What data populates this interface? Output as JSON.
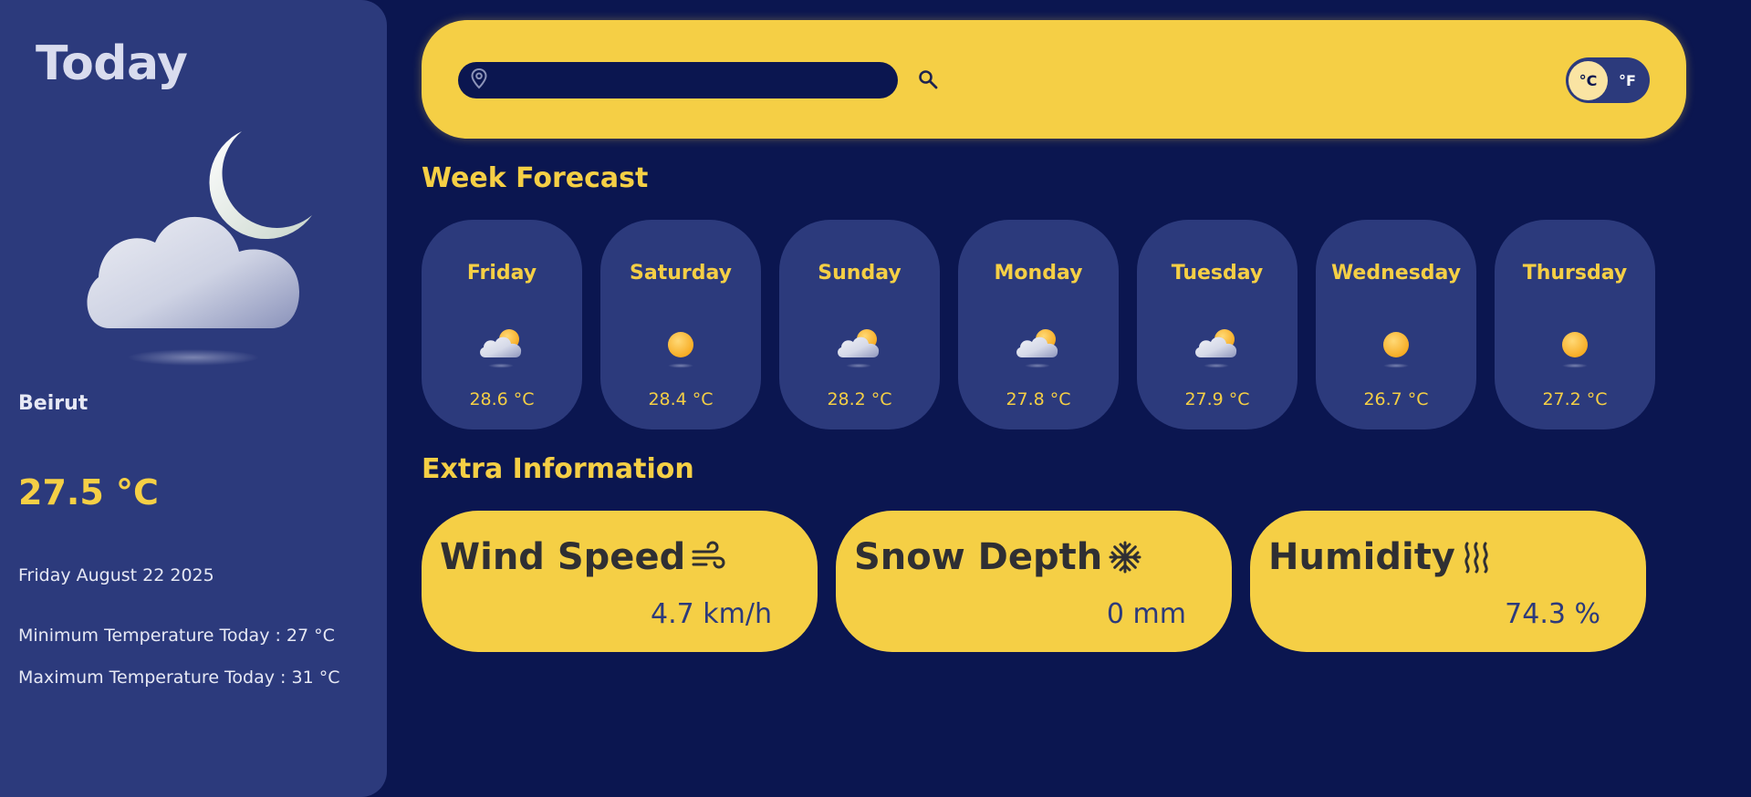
{
  "today": {
    "title": "Today",
    "city": "Beirut",
    "temperature": "27.5 °C",
    "date": "Friday August 22 2025",
    "min_temp": "Minimum Temperature Today : 27 °C",
    "max_temp": "Maximum Temperature Today : 31 °C",
    "icon": "moon-cloud-icon"
  },
  "search": {
    "placeholder": "",
    "value": "",
    "location_icon": "location-pin-icon",
    "search_icon": "search-icon"
  },
  "units": {
    "celsius_label": "°C",
    "fahrenheit_label": "°F",
    "selected": "celsius"
  },
  "week": {
    "title": "Week Forecast",
    "days": [
      {
        "name": "Friday",
        "temp": "28.6 °C",
        "icon": "partly-sunny-icon"
      },
      {
        "name": "Saturday",
        "temp": "28.4 °C",
        "icon": "sun-icon"
      },
      {
        "name": "Sunday",
        "temp": "28.2 °C",
        "icon": "partly-sunny-icon"
      },
      {
        "name": "Monday",
        "temp": "27.8 °C",
        "icon": "partly-sunny-icon"
      },
      {
        "name": "Tuesday",
        "temp": "27.9 °C",
        "icon": "partly-sunny-icon"
      },
      {
        "name": "Wednesday",
        "temp": "26.7 °C",
        "icon": "sun-icon"
      },
      {
        "name": "Thursday",
        "temp": "27.2 °C",
        "icon": "sun-icon"
      }
    ]
  },
  "extra": {
    "title": "Extra Information",
    "items": [
      {
        "label": "Wind Speed",
        "value": "4.7 km/h",
        "icon": "wind-icon"
      },
      {
        "label": "Snow Depth",
        "value": "0 mm",
        "icon": "snowflake-icon"
      },
      {
        "label": "Humidity",
        "value": "74.3 %",
        "icon": "humidity-icon"
      }
    ]
  },
  "colors": {
    "background": "#0b1650",
    "panel": "#2c3a7c",
    "accent": "#f5cf45"
  }
}
